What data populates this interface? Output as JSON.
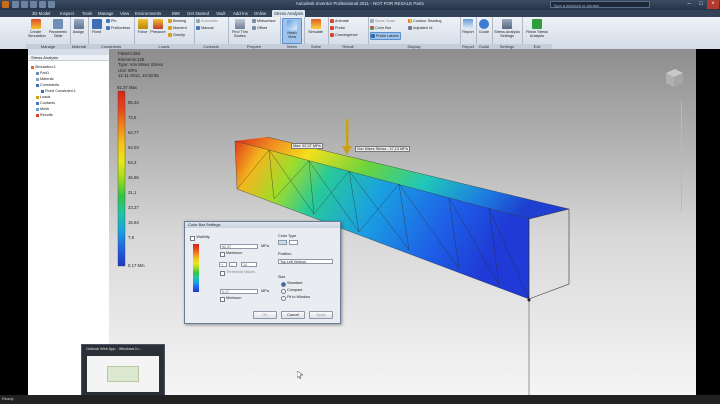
{
  "window": {
    "title": "Autodesk Inventor Professional 2011 - NOT FOR RESALE   Part1",
    "help_placeholder": "Type a keyword or phrase"
  },
  "tabs": [
    "3D Model",
    "Inspect",
    "Tools",
    "Manage",
    "View",
    "Environments",
    "BIM",
    "Get Started",
    "Vault",
    "Add-Ins",
    "Online",
    "Stress Analysis"
  ],
  "active_tab": "Stress Analysis",
  "ribbon": {
    "groups": {
      "manage": "Manage",
      "material": "Material",
      "constraints": "Constraints",
      "loads": "Loads",
      "contacts": "Contacts",
      "prepare": "Prepare",
      "mesh": "Mesh",
      "solve": "Solve",
      "result": "Result",
      "display": "Display",
      "report": "Report",
      "guide": "Guide",
      "settings": "Settings",
      "exit": "Exit"
    },
    "buttons": {
      "create_simulation": "Create Simulation",
      "parametric_table": "Parametric Table",
      "assign": "Assign",
      "fixed": "Fixed",
      "pin": "Pin",
      "frictionless": "Frictionless",
      "force": "Force",
      "pressure": "Pressure",
      "bearing": "Bearing",
      "moment": "Moment",
      "gravity": "Gravity",
      "automatic": "Automatic",
      "manual": "Manual",
      "find_thin_bodies": "Find Thin Bodies",
      "midsurface": "Midsurface",
      "offset": "Offset",
      "mesh_view": "Mesh View",
      "simulate": "Simulate",
      "animate": "Animate",
      "probe": "Probe",
      "convergence": "Convergence",
      "same_scale": "Same Scale",
      "color_bar": "Color Bar",
      "probe_labels": "Probe Labels",
      "contour_shading": "Contour Shading",
      "adjusted": "Adjusted x1",
      "report": "Report",
      "guide": "Guide",
      "stress_analysis_settings": "Stress Analysis Settings",
      "finish_stress_analysis": "Finish Stress Analysis"
    }
  },
  "browser": {
    "header": "Stress Analysis",
    "tree": [
      {
        "label": "Simulation:1",
        "level": 0
      },
      {
        "label": "Part1",
        "level": 1
      },
      {
        "label": "Material",
        "level": 1
      },
      {
        "label": "Constraints",
        "level": 1
      },
      {
        "label": "Fixed Constraint:1",
        "level": 2
      },
      {
        "label": "Loads",
        "level": 1
      },
      {
        "label": "Contacts",
        "level": 1
      },
      {
        "label": "Mesh",
        "level": 1
      },
      {
        "label": "Results",
        "level": 1
      }
    ]
  },
  "viewport": {
    "info": [
      "Pattern:393",
      "Elements:125",
      "Type: Von Mises Stress",
      "Unit: MPa",
      "12-11-2012, 10:48:55"
    ],
    "max_label": "92,37 Max",
    "min_label": "0,17 Min",
    "legend_ticks": [
      "85,24",
      "73,5",
      "64,77",
      "62,03",
      "54,3",
      "46,56",
      "31,1",
      "23,37",
      "15,63",
      "7,9"
    ],
    "legend_colors": [
      "#d8241b",
      "#e8451c",
      "#f0851c",
      "#f5c21a",
      "#e8e81a",
      "#9fdc1c",
      "#33c443",
      "#1ec7a4",
      "#16a4e0",
      "#1f62e6",
      "#2035c9"
    ],
    "probe_max": "Max: 92,37 MPa",
    "probe_vm": "Von Mises Stress : 47,13 MPa"
  },
  "dialog": {
    "title": "Color Bar Settings",
    "visibility": "Visibility",
    "max_value": "92,37",
    "maximum": "Maximum",
    "steps": "10",
    "intervals_label": "Threshold Values",
    "min_value": "0,17",
    "minimum": "Minimum",
    "unit": "MPa",
    "color_type": "Color Type",
    "position": "Position",
    "position_value": "Top Left Vertical",
    "size": "Size",
    "size_options": [
      "Standard",
      "Compact",
      "Fit to Window"
    ],
    "ok": "OK",
    "cancel": "Cancel",
    "apply": "Apply"
  },
  "taskbar_preview": {
    "title": "Outlook Web App - Windows In..."
  },
  "status": {
    "text": "Ready"
  }
}
